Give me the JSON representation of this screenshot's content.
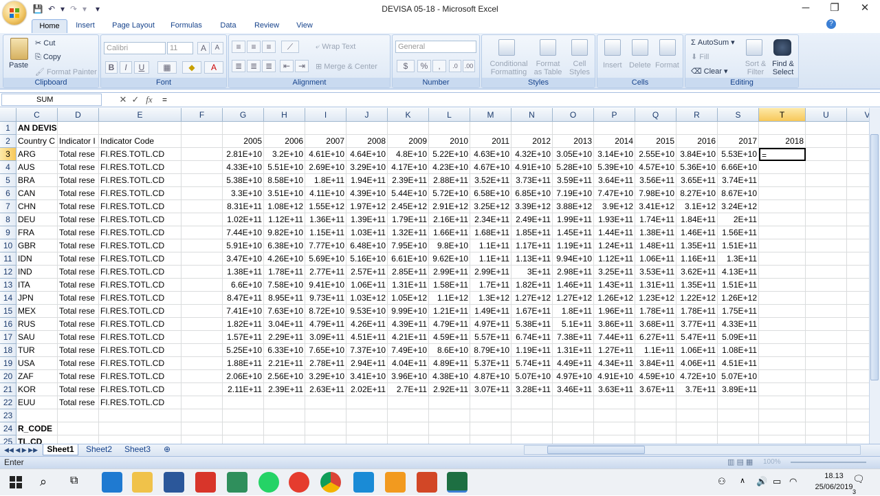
{
  "window": {
    "title": "DEVISA 05-18 - Microsoft Excel",
    "minimize_glyph": "─",
    "restore_glyph": "❐",
    "close_glyph": "✕"
  },
  "qat": {
    "save_glyph": "💾",
    "undo_glyph": "↶",
    "redo_glyph": "↷",
    "more_glyph": "▾"
  },
  "ribbon": {
    "tabs": [
      "Home",
      "Insert",
      "Page Layout",
      "Formulas",
      "Data",
      "Review",
      "View"
    ],
    "active_tab": "Home",
    "clipboard": {
      "label": "Clipboard",
      "paste": "Paste",
      "cut": "Cut",
      "copy": "Copy",
      "format_painter": "Format Painter"
    },
    "font": {
      "label": "Font",
      "font_name": "Calibri",
      "font_size": "11",
      "bold": "B",
      "italic": "I",
      "underline": "U"
    },
    "alignment": {
      "label": "Alignment",
      "wrap_text": "Wrap Text",
      "merge_center": "Merge & Center"
    },
    "number": {
      "label": "Number",
      "format": "General",
      "percent": "%"
    },
    "styles": {
      "label": "Styles",
      "conditional": "Conditional",
      "conditional2": "Formatting",
      "format_table": "Format",
      "format_table2": "as Table",
      "cell_styles": "Cell",
      "cell_styles2": "Styles"
    },
    "cells": {
      "label": "Cells",
      "insert": "Insert",
      "delete": "Delete",
      "format": "Format"
    },
    "editing": {
      "label": "Editing",
      "autosum": "AutoSum",
      "fill": "Fill",
      "clear": "Clear",
      "sort_filter": "Sort &",
      "sort_filter2": "Filter",
      "find_select": "Find &",
      "find_select2": "Select"
    }
  },
  "formula_bar": {
    "name_box": "SUM",
    "cancel": "✕",
    "enter": "✓",
    "fx": "fx",
    "formula": "="
  },
  "grid": {
    "columns": [
      "C",
      "D",
      "E",
      "F",
      "G",
      "H",
      "I",
      "J",
      "K",
      "L",
      "M",
      "N",
      "O",
      "P",
      "Q",
      "R",
      "S",
      "T",
      "U",
      "V",
      "W"
    ],
    "selected_column": "T",
    "selected_row": "3",
    "active_cell_value": "=",
    "rows": [
      {
        "n": "1",
        "C": "AN DEVISA"
      },
      {
        "n": "2",
        "C": "Country C",
        "D": "Indicator I",
        "E": "Indicator Code",
        "G": "2005",
        "H": "2006",
        "I": "2007",
        "J": "2008",
        "K": "2009",
        "L": "2010",
        "M": "2011",
        "N": "2012",
        "O": "2013",
        "P": "2014",
        "Q": "2015",
        "R": "2016",
        "S": "2017",
        "T": "2018"
      },
      {
        "n": "3",
        "C": "ARG",
        "D": "Total rese",
        "E": "FI.RES.TOTL.CD",
        "G": "2.81E+10",
        "H": "3.2E+10",
        "I": "4.61E+10",
        "J": "4.64E+10",
        "K": "4.8E+10",
        "L": "5.22E+10",
        "M": "4.63E+10",
        "N": "4.32E+10",
        "O": "3.05E+10",
        "P": "3.14E+10",
        "Q": "2.55E+10",
        "R": "3.84E+10",
        "S": "5.53E+10"
      },
      {
        "n": "4",
        "C": "AUS",
        "D": "Total rese",
        "E": "FI.RES.TOTL.CD",
        "G": "4.33E+10",
        "H": "5.51E+10",
        "I": "2.69E+10",
        "J": "3.29E+10",
        "K": "4.17E+10",
        "L": "4.23E+10",
        "M": "4.67E+10",
        "N": "4.91E+10",
        "O": "5.28E+10",
        "P": "5.39E+10",
        "Q": "4.57E+10",
        "R": "5.36E+10",
        "S": "6.66E+10"
      },
      {
        "n": "5",
        "C": "BRA",
        "D": "Total rese",
        "E": "FI.RES.TOTL.CD",
        "G": "5.38E+10",
        "H": "8.58E+10",
        "I": "1.8E+11",
        "J": "1.94E+11",
        "K": "2.39E+11",
        "L": "2.88E+11",
        "M": "3.52E+11",
        "N": "3.73E+11",
        "O": "3.59E+11",
        "P": "3.64E+11",
        "Q": "3.56E+11",
        "R": "3.65E+11",
        "S": "3.74E+11"
      },
      {
        "n": "6",
        "C": "CAN",
        "D": "Total rese",
        "E": "FI.RES.TOTL.CD",
        "G": "3.3E+10",
        "H": "3.51E+10",
        "I": "4.11E+10",
        "J": "4.39E+10",
        "K": "5.44E+10",
        "L": "5.72E+10",
        "M": "6.58E+10",
        "N": "6.85E+10",
        "O": "7.19E+10",
        "P": "7.47E+10",
        "Q": "7.98E+10",
        "R": "8.27E+10",
        "S": "8.67E+10"
      },
      {
        "n": "7",
        "C": "CHN",
        "D": "Total rese",
        "E": "FI.RES.TOTL.CD",
        "G": "8.31E+11",
        "H": "1.08E+12",
        "I": "1.55E+12",
        "J": "1.97E+12",
        "K": "2.45E+12",
        "L": "2.91E+12",
        "M": "3.25E+12",
        "N": "3.39E+12",
        "O": "3.88E+12",
        "P": "3.9E+12",
        "Q": "3.41E+12",
        "R": "3.1E+12",
        "S": "3.24E+12"
      },
      {
        "n": "8",
        "C": "DEU",
        "D": "Total rese",
        "E": "FI.RES.TOTL.CD",
        "G": "1.02E+11",
        "H": "1.12E+11",
        "I": "1.36E+11",
        "J": "1.39E+11",
        "K": "1.79E+11",
        "L": "2.16E+11",
        "M": "2.34E+11",
        "N": "2.49E+11",
        "O": "1.99E+11",
        "P": "1.93E+11",
        "Q": "1.74E+11",
        "R": "1.84E+11",
        "S": "2E+11"
      },
      {
        "n": "9",
        "C": "FRA",
        "D": "Total rese",
        "E": "FI.RES.TOTL.CD",
        "G": "7.44E+10",
        "H": "9.82E+10",
        "I": "1.15E+11",
        "J": "1.03E+11",
        "K": "1.32E+11",
        "L": "1.66E+11",
        "M": "1.68E+11",
        "N": "1.85E+11",
        "O": "1.45E+11",
        "P": "1.44E+11",
        "Q": "1.38E+11",
        "R": "1.46E+11",
        "S": "1.56E+11"
      },
      {
        "n": "10",
        "C": "GBR",
        "D": "Total rese",
        "E": "FI.RES.TOTL.CD",
        "G": "5.91E+10",
        "H": "6.38E+10",
        "I": "7.77E+10",
        "J": "6.48E+10",
        "K": "7.95E+10",
        "L": "9.8E+10",
        "M": "1.1E+11",
        "N": "1.17E+11",
        "O": "1.19E+11",
        "P": "1.24E+11",
        "Q": "1.48E+11",
        "R": "1.35E+11",
        "S": "1.51E+11"
      },
      {
        "n": "11",
        "C": "IDN",
        "D": "Total rese",
        "E": "FI.RES.TOTL.CD",
        "G": "3.47E+10",
        "H": "4.26E+10",
        "I": "5.69E+10",
        "J": "5.16E+10",
        "K": "6.61E+10",
        "L": "9.62E+10",
        "M": "1.1E+11",
        "N": "1.13E+11",
        "O": "9.94E+10",
        "P": "1.12E+11",
        "Q": "1.06E+11",
        "R": "1.16E+11",
        "S": "1.3E+11"
      },
      {
        "n": "12",
        "C": "IND",
        "D": "Total rese",
        "E": "FI.RES.TOTL.CD",
        "G": "1.38E+11",
        "H": "1.78E+11",
        "I": "2.77E+11",
        "J": "2.57E+11",
        "K": "2.85E+11",
        "L": "2.99E+11",
        "M": "2.99E+11",
        "N": "3E+11",
        "O": "2.98E+11",
        "P": "3.25E+11",
        "Q": "3.53E+11",
        "R": "3.62E+11",
        "S": "4.13E+11"
      },
      {
        "n": "13",
        "C": "ITA",
        "D": "Total rese",
        "E": "FI.RES.TOTL.CD",
        "G": "6.6E+10",
        "H": "7.58E+10",
        "I": "9.41E+10",
        "J": "1.06E+11",
        "K": "1.31E+11",
        "L": "1.58E+11",
        "M": "1.7E+11",
        "N": "1.82E+11",
        "O": "1.46E+11",
        "P": "1.43E+11",
        "Q": "1.31E+11",
        "R": "1.35E+11",
        "S": "1.51E+11"
      },
      {
        "n": "14",
        "C": "JPN",
        "D": "Total rese",
        "E": "FI.RES.TOTL.CD",
        "G": "8.47E+11",
        "H": "8.95E+11",
        "I": "9.73E+11",
        "J": "1.03E+12",
        "K": "1.05E+12",
        "L": "1.1E+12",
        "M": "1.3E+12",
        "N": "1.27E+12",
        "O": "1.27E+12",
        "P": "1.26E+12",
        "Q": "1.23E+12",
        "R": "1.22E+12",
        "S": "1.26E+12"
      },
      {
        "n": "15",
        "C": "MEX",
        "D": "Total rese",
        "E": "FI.RES.TOTL.CD",
        "G": "7.41E+10",
        "H": "7.63E+10",
        "I": "8.72E+10",
        "J": "9.53E+10",
        "K": "9.99E+10",
        "L": "1.21E+11",
        "M": "1.49E+11",
        "N": "1.67E+11",
        "O": "1.8E+11",
        "P": "1.96E+11",
        "Q": "1.78E+11",
        "R": "1.78E+11",
        "S": "1.75E+11"
      },
      {
        "n": "16",
        "C": "RUS",
        "D": "Total rese",
        "E": "FI.RES.TOTL.CD",
        "G": "1.82E+11",
        "H": "3.04E+11",
        "I": "4.79E+11",
        "J": "4.26E+11",
        "K": "4.39E+11",
        "L": "4.79E+11",
        "M": "4.97E+11",
        "N": "5.38E+11",
        "O": "5.1E+11",
        "P": "3.86E+11",
        "Q": "3.68E+11",
        "R": "3.77E+11",
        "S": "4.33E+11"
      },
      {
        "n": "17",
        "C": "SAU",
        "D": "Total rese",
        "E": "FI.RES.TOTL.CD",
        "G": "1.57E+11",
        "H": "2.29E+11",
        "I": "3.09E+11",
        "J": "4.51E+11",
        "K": "4.21E+11",
        "L": "4.59E+11",
        "M": "5.57E+11",
        "N": "6.74E+11",
        "O": "7.38E+11",
        "P": "7.44E+11",
        "Q": "6.27E+11",
        "R": "5.47E+11",
        "S": "5.09E+11"
      },
      {
        "n": "18",
        "C": "TUR",
        "D": "Total rese",
        "E": "FI.RES.TOTL.CD",
        "G": "5.25E+10",
        "H": "6.33E+10",
        "I": "7.65E+10",
        "J": "7.37E+10",
        "K": "7.49E+10",
        "L": "8.6E+10",
        "M": "8.79E+10",
        "N": "1.19E+11",
        "O": "1.31E+11",
        "P": "1.27E+11",
        "Q": "1.1E+11",
        "R": "1.06E+11",
        "S": "1.08E+11"
      },
      {
        "n": "19",
        "C": "USA",
        "D": "Total rese",
        "E": "FI.RES.TOTL.CD",
        "G": "1.88E+11",
        "H": "2.21E+11",
        "I": "2.78E+11",
        "J": "2.94E+11",
        "K": "4.04E+11",
        "L": "4.89E+11",
        "M": "5.37E+11",
        "N": "5.74E+11",
        "O": "4.49E+11",
        "P": "4.34E+11",
        "Q": "3.84E+11",
        "R": "4.06E+11",
        "S": "4.51E+11"
      },
      {
        "n": "20",
        "C": "ZAF",
        "D": "Total rese",
        "E": "FI.RES.TOTL.CD",
        "G": "2.06E+10",
        "H": "2.56E+10",
        "I": "3.29E+10",
        "J": "3.41E+10",
        "K": "3.96E+10",
        "L": "4.38E+10",
        "M": "4.87E+10",
        "N": "5.07E+10",
        "O": "4.97E+10",
        "P": "4.91E+10",
        "Q": "4.59E+10",
        "R": "4.72E+10",
        "S": "5.07E+10"
      },
      {
        "n": "21",
        "C": "KOR",
        "D": "Total rese",
        "E": "FI.RES.TOTL.CD",
        "G": "2.11E+11",
        "H": "2.39E+11",
        "I": "2.63E+11",
        "J": "2.02E+11",
        "K": "2.7E+11",
        "L": "2.92E+11",
        "M": "3.07E+11",
        "N": "3.28E+11",
        "O": "3.46E+11",
        "P": "3.63E+11",
        "Q": "3.67E+11",
        "R": "3.7E+11",
        "S": "3.89E+11"
      },
      {
        "n": "22",
        "C": "EUU",
        "D": "Total rese",
        "E": "FI.RES.TOTL.CD"
      },
      {
        "n": "23"
      },
      {
        "n": "24",
        "C": "R_CODE"
      },
      {
        "n": "25",
        "C": "TL.CD"
      }
    ]
  },
  "sheets": [
    "Sheet1",
    "Sheet2",
    "Sheet3"
  ],
  "active_sheet": "Sheet1",
  "status": {
    "mode": "Enter",
    "zoom": "100%"
  },
  "taskbar": {
    "time": "18.13",
    "date": "25/06/2019",
    "notifications": "3"
  },
  "colors": {
    "accent": "#15428b",
    "selected_header": "#f7c85a",
    "excel_green": "#1d6f42"
  }
}
